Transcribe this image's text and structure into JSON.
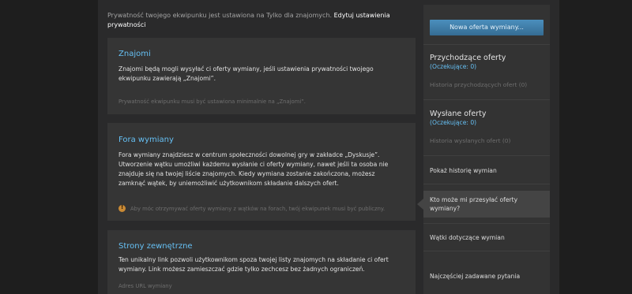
{
  "notice": {
    "text": "Prywatność twojego ekwipunku jest ustawiona na Tylko dla znajomych.",
    "link": "Edytuj ustawienia prywatności"
  },
  "panels": [
    {
      "title": "Znajomi",
      "body": "Znajomi będą mogli wysyłać ci oferty wymiany, jeśli ustawienia prywatności twojego ekwipunku zawierają „Znajomi”.",
      "note": "Prywatność ekwipunku musi być ustawiona minimalnie na „Znajomi”."
    },
    {
      "title": "Fora wymiany",
      "body": "Fora wymiany znajdziesz w centrum społeczności dowolnej gry w zakładce „Dyskusje”. Utworzenie wątku umożliwi każdemu wysłanie ci oferty wymiany, nawet jeśli ta osoba nie znajduje się na twojej liście znajomych. Kiedy wymiana zostanie zakończona, możesz zamknąć wątek, by uniemożliwić użytkownikom składanie dalszych ofert.",
      "note": "Aby móc otrzymywać oferty wymiany z wątków na forach, twój ekwipunek musi być publiczny."
    },
    {
      "title": "Strony zewnętrzne",
      "body": "Ten unikalny link pozwoli użytkownikom spoza twojej listy znajomych na składanie ci ofert wymiany. Link możesz zamieszczać gdzie tylko zechcesz bez żadnych ograniczeń.",
      "note": "Adres URL wymiany"
    }
  ],
  "sidebar": {
    "new_offer_button": "Nowa oferta wymiany...",
    "incoming": {
      "title": "Przychodzące oferty",
      "pending": "(Oczekujące: 0)",
      "history": "Historia przychodzących ofert (0)"
    },
    "sent": {
      "title": "Wysłane oferty",
      "pending": "(Oczekujące: 0)",
      "history": "Historia wysłanych ofert (0)"
    },
    "links": [
      "Pokaż historię wymian",
      "Kto może mi przesyłać oferty wymiany?",
      "Wątki dotyczące wymian",
      "Najczęściej zadawane pytania"
    ]
  },
  "colors": {
    "background": "#1e1e1e",
    "page": "#2a2a2b",
    "panel": "#353535",
    "link_blue": "#66c0f4",
    "button": "#4b8fbd"
  }
}
